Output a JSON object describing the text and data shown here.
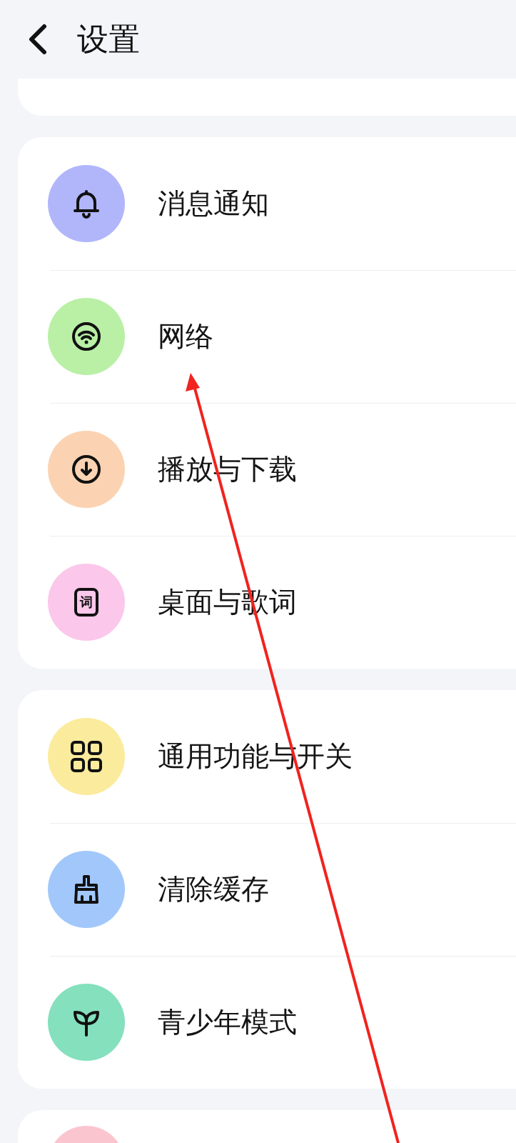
{
  "header": {
    "title": "设置"
  },
  "sections": [
    {
      "kind": "tail"
    },
    {
      "kind": "full",
      "items": [
        {
          "kind": "bell",
          "color": "#b1b6fb",
          "label": "消息通知"
        },
        {
          "kind": "wifi",
          "color": "#b9f0a6",
          "label": "网络"
        },
        {
          "kind": "download",
          "color": "#fbd3b2",
          "label": "播放与下载"
        },
        {
          "kind": "lyrics",
          "color": "#fbc7ea",
          "label": "桌面与歌词",
          "glyph": "词"
        }
      ]
    },
    {
      "kind": "full",
      "items": [
        {
          "kind": "grid",
          "color": "#fbeb9c",
          "label": "通用功能与开关"
        },
        {
          "kind": "brush",
          "color": "#a2c8fb",
          "label": "清除缓存"
        },
        {
          "kind": "sprout",
          "color": "#84e0bd",
          "label": "青少年模式"
        }
      ]
    },
    {
      "kind": "head",
      "items": [
        {
          "color": "#fbc5cf"
        }
      ]
    }
  ]
}
